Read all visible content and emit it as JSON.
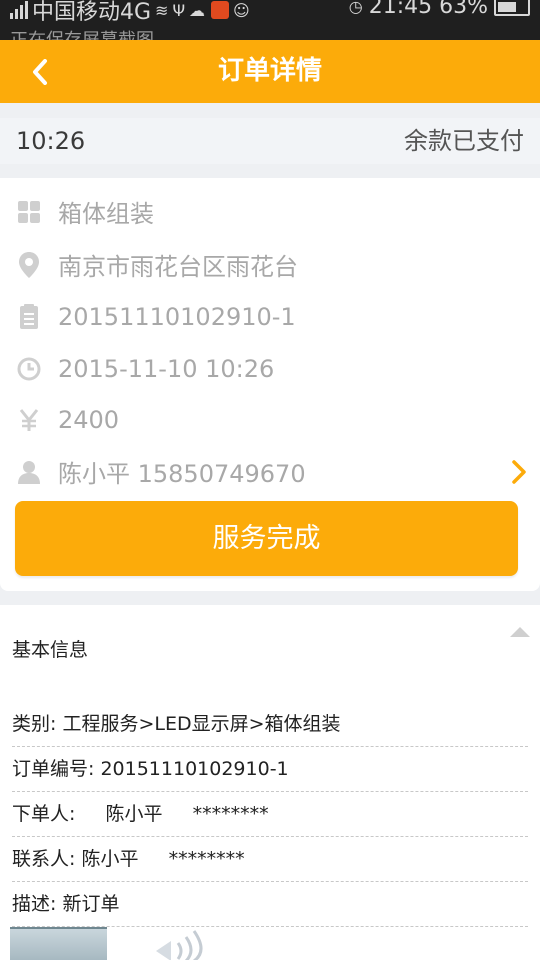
{
  "status_bar": {
    "carrier": "中国移动4G",
    "time_battery": "21:45 63%",
    "notification": "正在保存屏幕截图"
  },
  "header": {
    "title": "订单详情"
  },
  "order_status": {
    "time": "10:26",
    "payment_status": "余款已支付"
  },
  "info": {
    "service_type": "箱体组装",
    "address": "南京市雨花台区雨花台",
    "order_number": "20151110102910-1",
    "datetime": "2015-11-10 10:26",
    "price": "2400",
    "contact": "陈小平 15850749670"
  },
  "complete_button_label": "服务完成",
  "basic_info": {
    "section_title": "基本信息",
    "category_label": "类别:",
    "category_value": "工程服务>LED显示屏>箱体组装",
    "order_no_label": "订单编号:",
    "order_no_value": "20151110102910-1",
    "orderer_label": "下单人:",
    "orderer_name": "陈小平",
    "orderer_phone": "********",
    "contact_label": "联系人:",
    "contact_name": "陈小平",
    "contact_phone": "********",
    "desc_label": "描述:",
    "desc_value": "新订单"
  },
  "colors": {
    "accent": "#fcab0a",
    "background": "#eef0f3",
    "muted_text": "#a8a8a8",
    "icon_gray": "#cfcfcf"
  }
}
